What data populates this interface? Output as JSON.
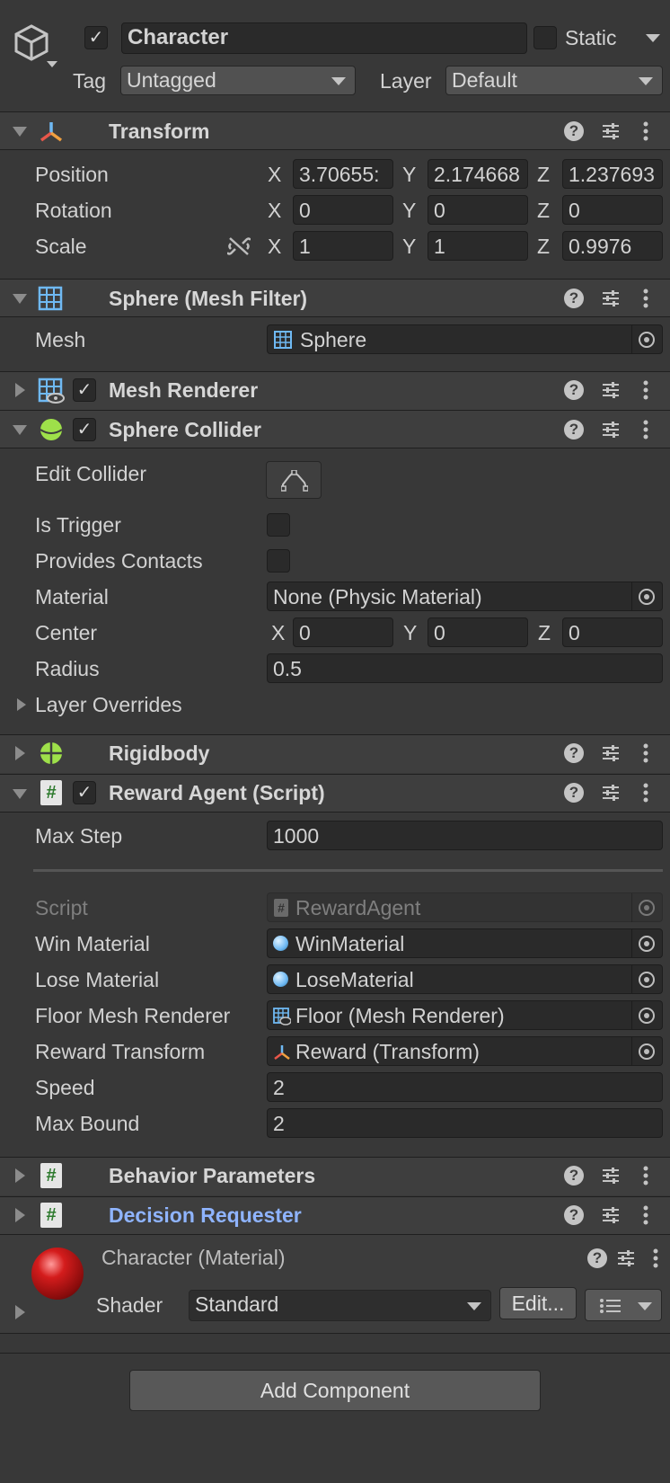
{
  "object": {
    "name": "Character",
    "active": true,
    "static_label": "Static",
    "tag_label": "Tag",
    "tag_value": "Untagged",
    "layer_label": "Layer",
    "layer_value": "Default"
  },
  "transform": {
    "title": "Transform",
    "position_label": "Position",
    "rotation_label": "Rotation",
    "scale_label": "Scale",
    "position": {
      "x": "3.70655:",
      "y": "2.174668",
      "z": "1.237693"
    },
    "rotation": {
      "x": "0",
      "y": "0",
      "z": "0"
    },
    "scale": {
      "x": "1",
      "y": "1",
      "z": "0.9976"
    },
    "axis_x": "X",
    "axis_y": "Y",
    "axis_z": "Z"
  },
  "mesh_filter": {
    "title": "Sphere (Mesh Filter)",
    "mesh_label": "Mesh",
    "mesh_value": "Sphere"
  },
  "mesh_renderer": {
    "title": "Mesh Renderer"
  },
  "sphere_collider": {
    "title": "Sphere Collider",
    "edit_collider_label": "Edit Collider",
    "is_trigger_label": "Is Trigger",
    "provides_contacts_label": "Provides Contacts",
    "material_label": "Material",
    "material_value": "None (Physic Material)",
    "center_label": "Center",
    "center": {
      "x": "0",
      "y": "0",
      "z": "0"
    },
    "radius_label": "Radius",
    "radius_value": "0.5",
    "layer_overrides_label": "Layer Overrides"
  },
  "rigidbody": {
    "title": "Rigidbody"
  },
  "reward_agent": {
    "title": "Reward Agent (Script)",
    "max_step_label": "Max Step",
    "max_step_value": "1000",
    "script_label": "Script",
    "script_value": "RewardAgent",
    "win_material_label": "Win Material",
    "win_material_value": "WinMaterial",
    "lose_material_label": "Lose Material",
    "lose_material_value": "LoseMaterial",
    "floor_mesh_label": "Floor Mesh Renderer",
    "floor_mesh_value": "Floor (Mesh Renderer)",
    "reward_transform_label": "Reward Transform",
    "reward_transform_value": "Reward (Transform)",
    "speed_label": "Speed",
    "speed_value": "2",
    "max_bound_label": "Max Bound",
    "max_bound_value": "2"
  },
  "behavior_parameters": {
    "title": "Behavior Parameters"
  },
  "decision_requester": {
    "title": "Decision Requester"
  },
  "material": {
    "title": "Character (Material)",
    "shader_label": "Shader",
    "shader_value": "Standard",
    "edit_label": "Edit..."
  },
  "add_component_label": "Add Component",
  "colors": {
    "background": "#383838",
    "header": "#3e3e3e",
    "field": "#2a2a2a",
    "accent_link": "#8fb4ff"
  }
}
